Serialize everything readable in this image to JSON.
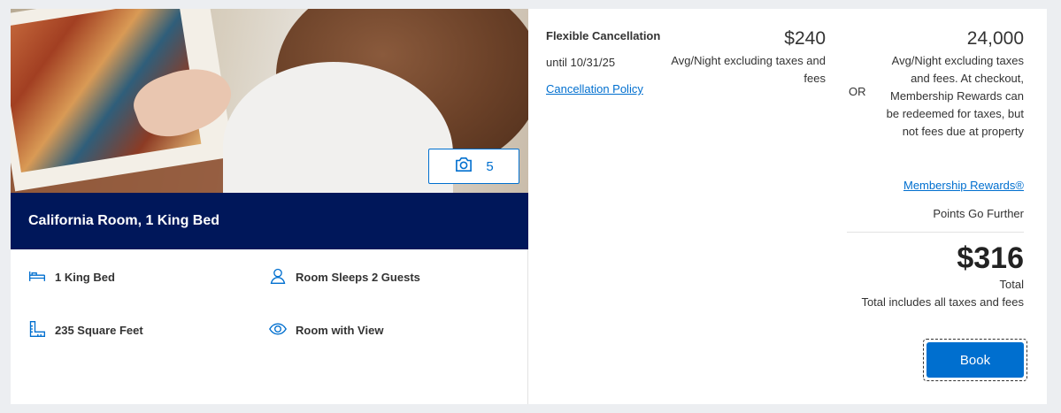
{
  "photo": {
    "count": "5",
    "icon": "camera-icon"
  },
  "room": {
    "title": "California Room, 1 King Bed"
  },
  "amenities": [
    {
      "label": "1 King Bed",
      "icon": "bed-icon"
    },
    {
      "label": "Room Sleeps 2 Guests",
      "icon": "person-icon"
    },
    {
      "label": "235 Square Feet",
      "icon": "ruler-icon"
    },
    {
      "label": "Room with View",
      "icon": "eye-icon"
    }
  ],
  "cancellation": {
    "title": "Flexible Cancellation",
    "until": "until 10/31/25",
    "policy_link": "Cancellation Policy"
  },
  "price": {
    "amount": "$240",
    "note": "Avg/Night excluding taxes and fees"
  },
  "or_label": "OR",
  "points": {
    "amount": "24,000",
    "note": "Avg/Night excluding taxes and fees. At checkout, Membership Rewards can be redeemed for taxes, but not fees due at property",
    "link": "Membership Rewards®",
    "tagline": "Points Go Further"
  },
  "total": {
    "amount": "$316",
    "label": "Total",
    "note": "Total includes all taxes and fees"
  },
  "book_button": "Book",
  "colors": {
    "accent": "#006fcf",
    "navy": "#00175a"
  }
}
